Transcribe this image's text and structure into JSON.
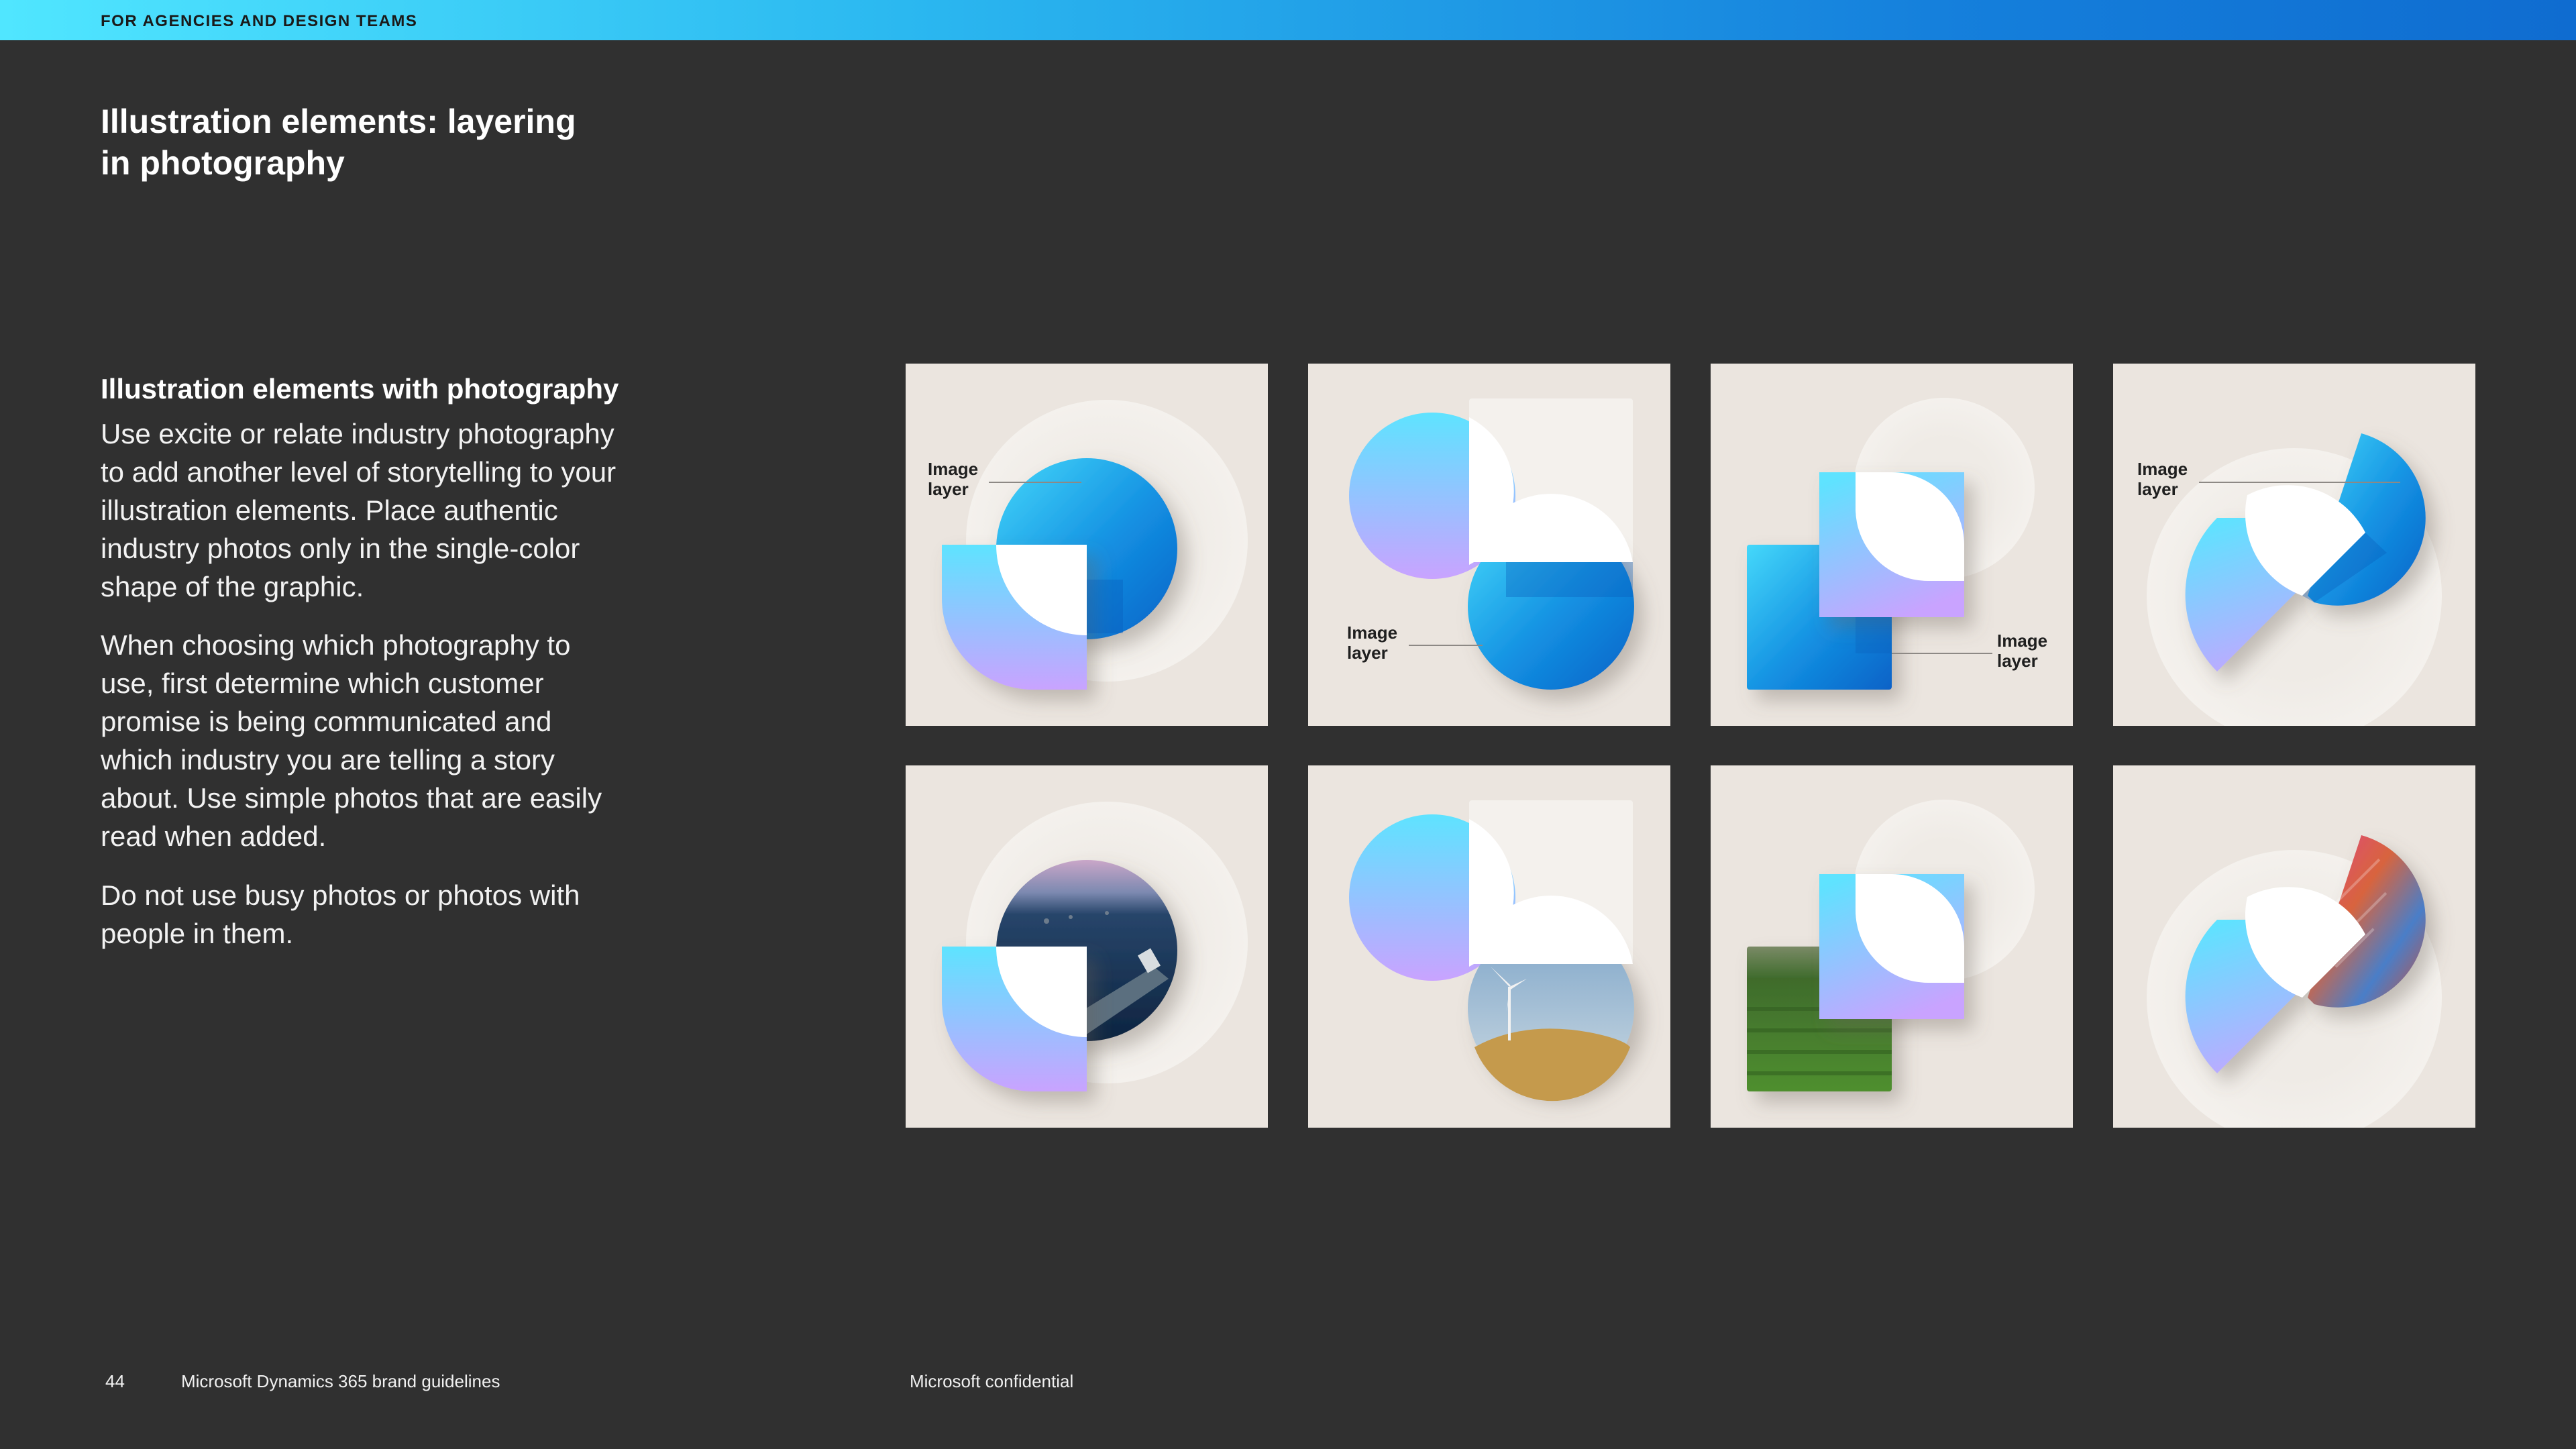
{
  "header": {
    "label": "FOR AGENCIES AND DESIGN TEAMS"
  },
  "page": {
    "title": "Illustration elements: layering in photography",
    "section_heading": "Illustration elements with photography",
    "paragraphs": [
      "Use excite or relate industry photography to add another level of storytelling to your illustration elements. Place authentic industry photos only in the single-color shape of the graphic.",
      "When choosing which photography to use, first determine which customer promise is being communicated and which industry you are telling a story about. Use simple photos that are easily read when added.",
      "Do not use busy photos or photos with people in them."
    ]
  },
  "tiles": {
    "callout": "Image layer",
    "items": [
      {
        "name": "circle-quarter-illustration",
        "photo": "none"
      },
      {
        "name": "circle-overlap-illustration",
        "photo": "none"
      },
      {
        "name": "leaf-square-illustration",
        "photo": "none"
      },
      {
        "name": "diagonal-fan-illustration",
        "photo": "none"
      },
      {
        "name": "circle-quarter-photo",
        "photo": "cargo ship at sea"
      },
      {
        "name": "circle-overlap-photo",
        "photo": "wind turbine on hill"
      },
      {
        "name": "leaf-square-photo",
        "photo": "green crop field"
      },
      {
        "name": "diagonal-fan-photo",
        "photo": "shipping containers"
      }
    ]
  },
  "footer": {
    "page_number": "44",
    "doc_title": "Microsoft Dynamics 365 brand guidelines",
    "confidential": "Microsoft confidential"
  },
  "colors": {
    "background": "#303030",
    "tile": "#ebe5df",
    "accent_blue": "#0f6cd0",
    "accent_cyan": "#50e6ff",
    "accent_purple": "#c9a8ff"
  }
}
